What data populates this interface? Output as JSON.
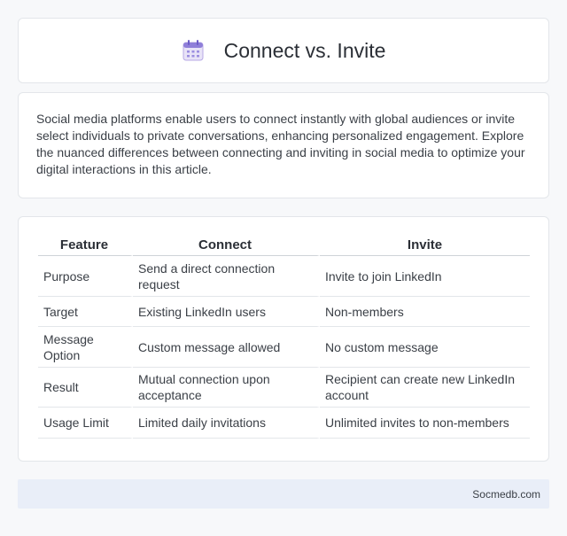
{
  "header": {
    "title": "Connect vs. Invite",
    "icon": "calendar-icon"
  },
  "intro": {
    "text": "Social media platforms enable users to connect instantly with global audiences or invite select individuals to private conversations, enhancing personalized engagement. Explore the nuanced differences between connecting and inviting in social media to optimize your digital interactions in this article."
  },
  "table": {
    "headers": [
      "Feature",
      "Connect",
      "Invite"
    ],
    "rows": [
      [
        "Purpose",
        "Send a direct connection request",
        "Invite to join LinkedIn"
      ],
      [
        "Target",
        "Existing LinkedIn users",
        "Non-members"
      ],
      [
        "Message Option",
        "Custom message allowed",
        "No custom message"
      ],
      [
        "Result",
        "Mutual connection upon acceptance",
        "Recipient can create new LinkedIn account"
      ],
      [
        "Usage Limit",
        "Limited daily invitations",
        "Unlimited invites to non-members"
      ]
    ]
  },
  "footer": {
    "site": "Socmedb.com"
  }
}
